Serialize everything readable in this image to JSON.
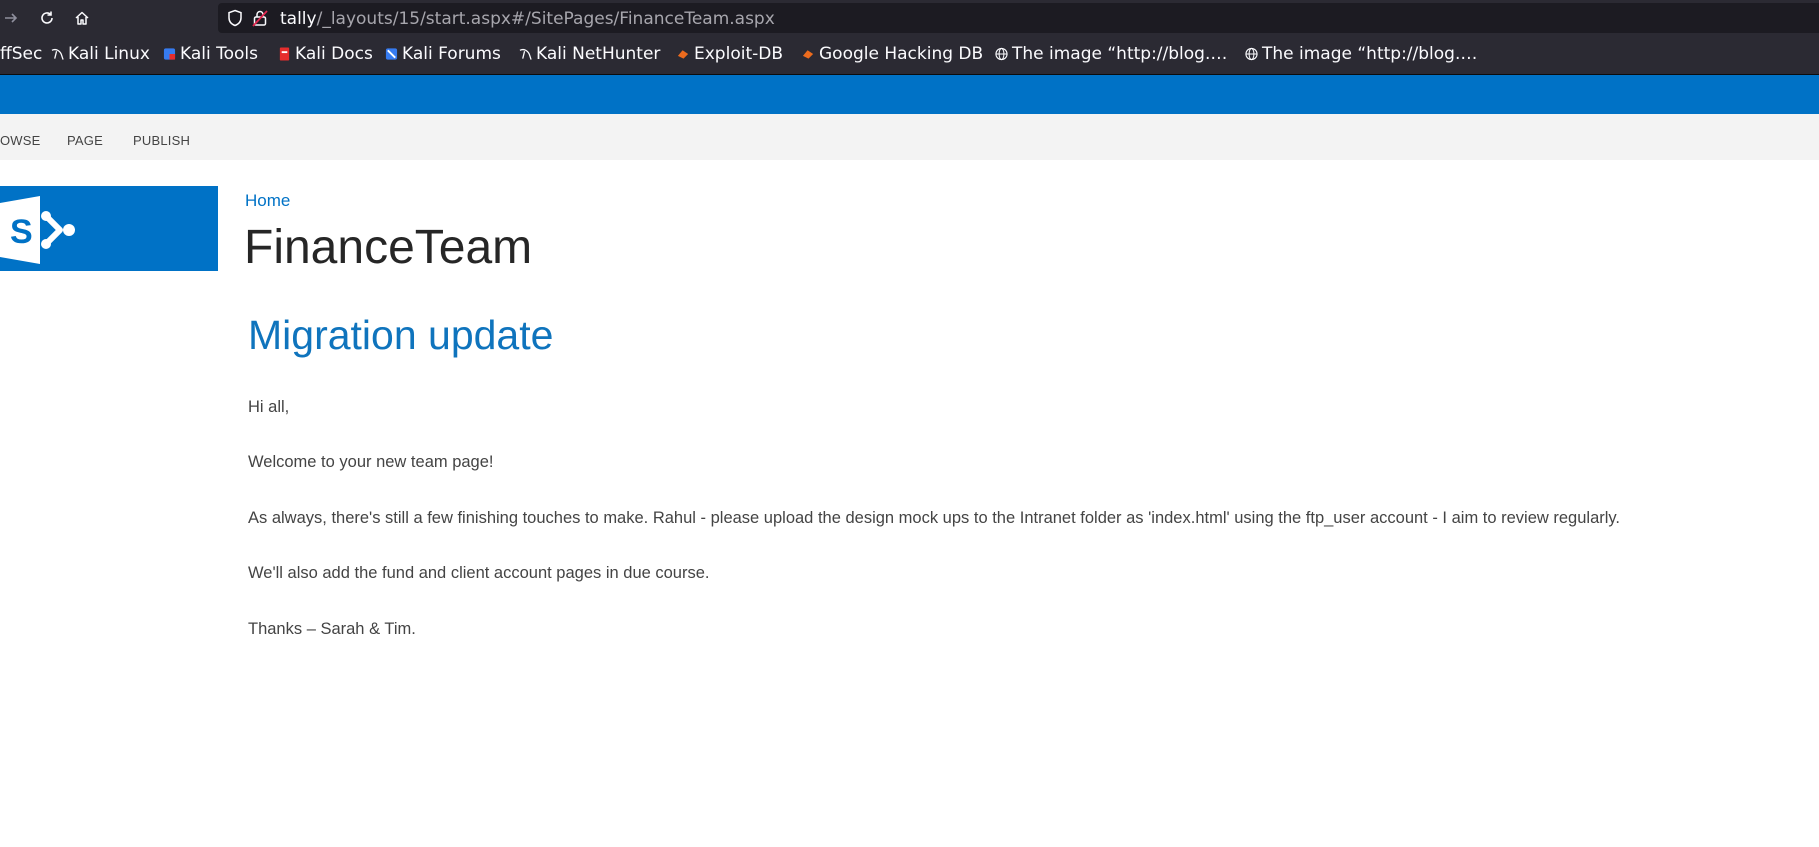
{
  "browser": {
    "url_host": "tally",
    "url_path": "/_layouts/15/start.aspx#/SitePages/FinanceTeam.aspx",
    "icons": {
      "forward": "arrow-right-icon",
      "reload": "reload-icon",
      "home": "home-icon",
      "shield": "shield-icon",
      "lock": "insecure-lock-icon"
    }
  },
  "bookmarks": [
    {
      "label": "ffSec",
      "icon": ""
    },
    {
      "label": "Kali Linux",
      "icon": "kali-dragon-icon"
    },
    {
      "label": "Kali Tools",
      "icon": "kali-tools-icon"
    },
    {
      "label": "Kali Docs",
      "icon": "kali-docs-icon"
    },
    {
      "label": "Kali Forums",
      "icon": "kali-forums-icon"
    },
    {
      "label": "Kali NetHunter",
      "icon": "kali-dragon-icon"
    },
    {
      "label": "Exploit-DB",
      "icon": "exploit-db-icon"
    },
    {
      "label": "Google Hacking DB",
      "icon": "exploit-db-icon"
    },
    {
      "label": "The image “http://blog.…",
      "icon": "globe-icon"
    },
    {
      "label": "The image “http://blog.…",
      "icon": "globe-icon"
    }
  ],
  "ribbon": {
    "tabs": [
      "OWSE",
      "PAGE",
      "PUBLISH"
    ]
  },
  "site": {
    "breadcrumb": "Home",
    "title": "FinanceTeam",
    "logo_letter": "S",
    "brand_color": "#0072c6"
  },
  "post": {
    "heading": "Migration update",
    "paragraphs": [
      "Hi all,",
      "Welcome to your new team page!",
      "As always, there's still a few finishing touches to make.  Rahul - please upload the design mock ups to the Intranet folder as 'index.html' using the ftp_user account - I aim to review regularly.",
      "We'll also add the fund and client account pages in due course.",
      "Thanks – Sarah & Tim."
    ]
  }
}
